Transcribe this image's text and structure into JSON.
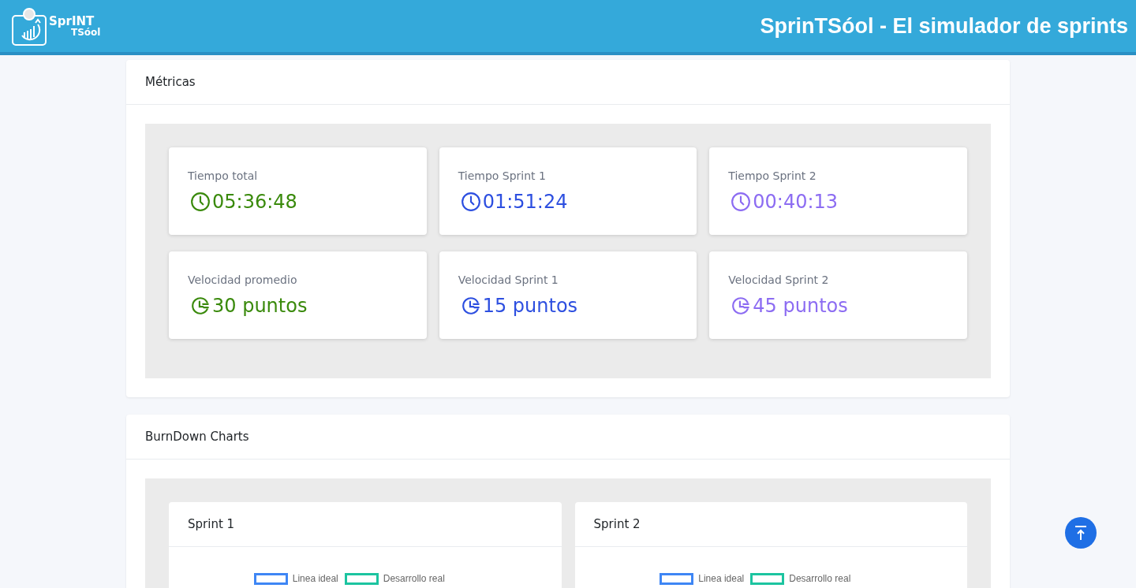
{
  "header": {
    "logo": {
      "line_1": "SprINT",
      "line_2": "TSóol"
    },
    "title": "SprinTSóol - El simulador de sprints"
  },
  "metrics": {
    "title": "Métricas",
    "items": [
      {
        "kind": "time",
        "label": "Tiempo total",
        "value": "05:36:48",
        "color": "#3a8a0c"
      },
      {
        "kind": "time",
        "label": "Tiempo Sprint 1",
        "value": "01:51:24",
        "color": "#2d4fe0"
      },
      {
        "kind": "time",
        "label": "Tiempo Sprint 2",
        "value": "00:40:13",
        "color": "#8c6cf2"
      },
      {
        "kind": "velocity",
        "label": "Velocidad promedio",
        "value": "30 puntos",
        "color": "#3a8a0c"
      },
      {
        "kind": "velocity",
        "label": "Velocidad Sprint 1",
        "value": "15 puntos",
        "color": "#2d4fe0"
      },
      {
        "kind": "velocity",
        "label": "Velocidad Sprint 2",
        "value": "45 puntos",
        "color": "#8c6cf2"
      }
    ]
  },
  "burndown": {
    "title": "BurnDown Charts",
    "charts": [
      {
        "title": "Sprint 1",
        "legend": [
          {
            "label": "Linea ideal",
            "color": "#3e86f5"
          },
          {
            "label": "Desarrollo real",
            "color": "#1cc4a0"
          }
        ]
      },
      {
        "title": "Sprint 2",
        "legend": [
          {
            "label": "Linea ideal",
            "color": "#3e86f5"
          },
          {
            "label": "Desarrollo real",
            "color": "#1cc4a0"
          }
        ]
      }
    ]
  }
}
